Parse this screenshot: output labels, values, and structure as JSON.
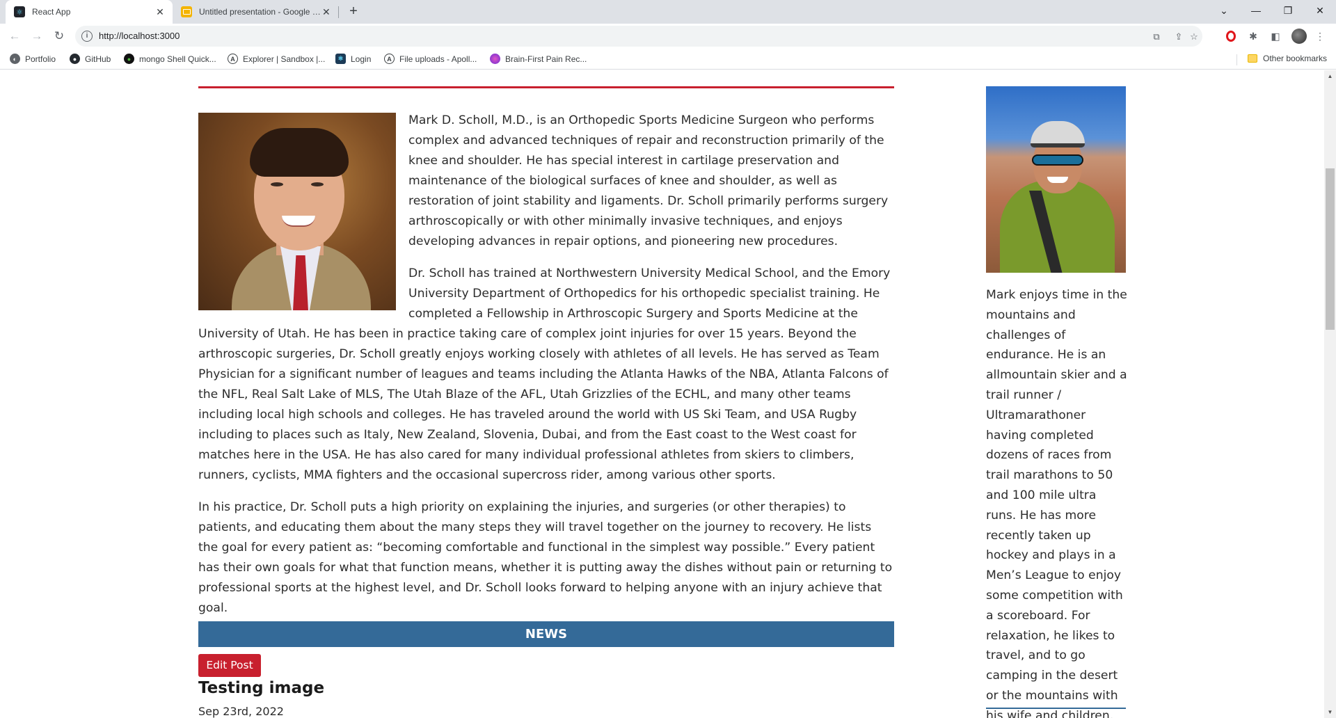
{
  "browser": {
    "tabs": [
      {
        "title": "React App",
        "active": true,
        "icon": "react-icon"
      },
      {
        "title": "Untitled presentation - Google Slides",
        "active": false,
        "icon": "google-slides-icon"
      }
    ],
    "new_tab_symbol": "+",
    "window_controls": {
      "collapse": "⌄",
      "minimize": "—",
      "restore": "❐",
      "close": "✕"
    },
    "url": "http://localhost:3000",
    "bookmarks": [
      {
        "label": "Portfolio",
        "icon": "portfolio-icon"
      },
      {
        "label": "GitHub",
        "icon": "github-icon"
      },
      {
        "label": "mongo Shell Quick...",
        "icon": "mongodb-leaf-icon"
      },
      {
        "label": "Explorer | Sandbox |...",
        "icon": "apollo-icon"
      },
      {
        "label": "Login",
        "icon": "login-favicon-icon"
      },
      {
        "label": "File uploads - Apoll...",
        "icon": "apollo-icon"
      },
      {
        "label": "Brain-First Pain Rec...",
        "icon": "brain-icon"
      }
    ],
    "other_bookmarks": "Other bookmarks"
  },
  "page": {
    "bio_paragraphs": [
      "Mark D. Scholl, M.D., is an Orthopedic Sports Medicine Surgeon who performs complex and advanced techniques of repair and reconstruction primarily of the knee and shoulder. He has special interest in cartilage preservation and maintenance of the biological surfaces of knee and shoulder, as well as restoration of joint stability and ligaments. Dr. Scholl primarily performs surgery arthroscopically or with other minimally invasive techniques, and enjoys developing advances in repair options, and pioneering new procedures.",
      "Dr. Scholl has trained at Northwestern University Medical School, and the Emory University Department of Orthopedics for his orthopedic specialist training. He completed a Fellowship in Arthroscopic Surgery and Sports Medicine at the University of Utah. He has been in practice taking care of complex joint injuries for over 15 years. Beyond the arthroscopic surgeries, Dr. Scholl greatly enjoys working closely with athletes of all levels. He has served as Team Physician for a significant number of leagues and teams including the Atlanta Hawks of the NBA, Atlanta Falcons of the NFL, Real Salt Lake of MLS, The Utah Blaze of the AFL, Utah Grizzlies of the ECHL, and many other teams including local high schools and colleges. He has traveled around the world with US Ski Team, and USA Rugby including to places such as Italy, New Zealand, Slovenia, Dubai, and from the East coast to the West coast for matches here in the USA. He has also cared for many individual professional athletes from skiers to climbers, runners, cyclists, MMA fighters and the occasional supercross rider, among various other sports.",
      "In his practice, Dr. Scholl puts a high priority on explaining the injuries, and surgeries (or other therapies) to patients, and educating them about the many steps they will travel together on the journey to recovery. He lists the goal for every patient as: “becoming comfortable and functional in the simplest way possible.” Every patient has their own goals for what that function means, whether it is putting away the dishes without pain or returning to professional sports at the highest level, and Dr. Scholl looks forward to helping anyone with an injury achieve that goal."
    ],
    "news_heading": "NEWS",
    "edit_post_label": "Edit Post",
    "post": {
      "title": "Testing image",
      "date": "Sep 23rd, 2022"
    },
    "sidebar_text": "Mark enjoys time in the mountains and challenges of endurance. He is an allmountain skier and a trail runner / Ultramarathoner having completed dozens of races from trail marathons to 50 and 100 mile ultra runs. He has more recently taken up hockey and plays in a Men’s League to enjoy some competition with a scoreboard. For relaxation, he likes to travel, and to go camping in the desert or the mountains with his wife and children."
  },
  "colors": {
    "accent_red": "#c8202e",
    "news_blue": "#346a98"
  }
}
